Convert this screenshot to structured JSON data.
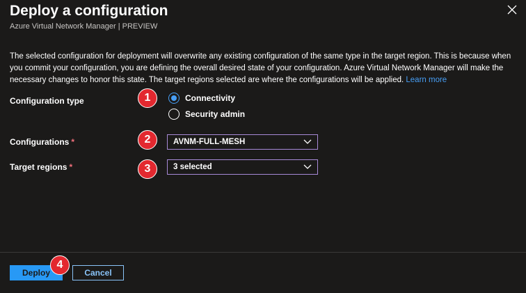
{
  "header": {
    "title": "Deploy a configuration",
    "subtitle": "Azure Virtual Network Manager | PREVIEW"
  },
  "description": {
    "text": "The selected configuration for deployment will overwrite any existing configuration of the same type in the target region. This is because when you commit your configuration, you are defining the overall desired state of your configuration. Azure Virtual Network Manager will make the necessary changes to honor this state. The target regions selected are where the configurations will be applied.",
    "link": "Learn more"
  },
  "form": {
    "configuration_type": {
      "label": "Configuration type",
      "options": [
        {
          "label": "Connectivity",
          "checked": true
        },
        {
          "label": "Security admin",
          "checked": false
        }
      ]
    },
    "configurations": {
      "label": "Configurations",
      "required_mark": "*",
      "value": "AVNM-FULL-MESH"
    },
    "target_regions": {
      "label": "Target regions",
      "required_mark": "*",
      "value": "3 selected"
    }
  },
  "markers": [
    "1",
    "2",
    "3",
    "4"
  ],
  "footer": {
    "deploy_label": "Deploy",
    "cancel_label": "Cancel"
  },
  "colors": {
    "background": "#1b1a19",
    "accent": "#479ef5",
    "primary_button": "#2899f5",
    "marker": "#e3282f",
    "dropdown_border": "#a88ad8"
  },
  "icons": [
    "close-icon",
    "chevron-down-icon"
  ]
}
